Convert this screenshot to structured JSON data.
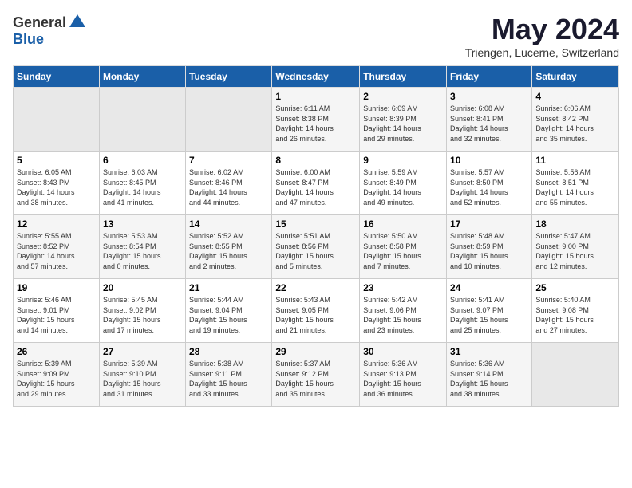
{
  "logo": {
    "general": "General",
    "blue": "Blue"
  },
  "title": "May 2024",
  "subtitle": "Triengen, Lucerne, Switzerland",
  "headers": [
    "Sunday",
    "Monday",
    "Tuesday",
    "Wednesday",
    "Thursday",
    "Friday",
    "Saturday"
  ],
  "weeks": [
    [
      {
        "day": "",
        "info": ""
      },
      {
        "day": "",
        "info": ""
      },
      {
        "day": "",
        "info": ""
      },
      {
        "day": "1",
        "info": "Sunrise: 6:11 AM\nSunset: 8:38 PM\nDaylight: 14 hours\nand 26 minutes."
      },
      {
        "day": "2",
        "info": "Sunrise: 6:09 AM\nSunset: 8:39 PM\nDaylight: 14 hours\nand 29 minutes."
      },
      {
        "day": "3",
        "info": "Sunrise: 6:08 AM\nSunset: 8:41 PM\nDaylight: 14 hours\nand 32 minutes."
      },
      {
        "day": "4",
        "info": "Sunrise: 6:06 AM\nSunset: 8:42 PM\nDaylight: 14 hours\nand 35 minutes."
      }
    ],
    [
      {
        "day": "5",
        "info": "Sunrise: 6:05 AM\nSunset: 8:43 PM\nDaylight: 14 hours\nand 38 minutes."
      },
      {
        "day": "6",
        "info": "Sunrise: 6:03 AM\nSunset: 8:45 PM\nDaylight: 14 hours\nand 41 minutes."
      },
      {
        "day": "7",
        "info": "Sunrise: 6:02 AM\nSunset: 8:46 PM\nDaylight: 14 hours\nand 44 minutes."
      },
      {
        "day": "8",
        "info": "Sunrise: 6:00 AM\nSunset: 8:47 PM\nDaylight: 14 hours\nand 47 minutes."
      },
      {
        "day": "9",
        "info": "Sunrise: 5:59 AM\nSunset: 8:49 PM\nDaylight: 14 hours\nand 49 minutes."
      },
      {
        "day": "10",
        "info": "Sunrise: 5:57 AM\nSunset: 8:50 PM\nDaylight: 14 hours\nand 52 minutes."
      },
      {
        "day": "11",
        "info": "Sunrise: 5:56 AM\nSunset: 8:51 PM\nDaylight: 14 hours\nand 55 minutes."
      }
    ],
    [
      {
        "day": "12",
        "info": "Sunrise: 5:55 AM\nSunset: 8:52 PM\nDaylight: 14 hours\nand 57 minutes."
      },
      {
        "day": "13",
        "info": "Sunrise: 5:53 AM\nSunset: 8:54 PM\nDaylight: 15 hours\nand 0 minutes."
      },
      {
        "day": "14",
        "info": "Sunrise: 5:52 AM\nSunset: 8:55 PM\nDaylight: 15 hours\nand 2 minutes."
      },
      {
        "day": "15",
        "info": "Sunrise: 5:51 AM\nSunset: 8:56 PM\nDaylight: 15 hours\nand 5 minutes."
      },
      {
        "day": "16",
        "info": "Sunrise: 5:50 AM\nSunset: 8:58 PM\nDaylight: 15 hours\nand 7 minutes."
      },
      {
        "day": "17",
        "info": "Sunrise: 5:48 AM\nSunset: 8:59 PM\nDaylight: 15 hours\nand 10 minutes."
      },
      {
        "day": "18",
        "info": "Sunrise: 5:47 AM\nSunset: 9:00 PM\nDaylight: 15 hours\nand 12 minutes."
      }
    ],
    [
      {
        "day": "19",
        "info": "Sunrise: 5:46 AM\nSunset: 9:01 PM\nDaylight: 15 hours\nand 14 minutes."
      },
      {
        "day": "20",
        "info": "Sunrise: 5:45 AM\nSunset: 9:02 PM\nDaylight: 15 hours\nand 17 minutes."
      },
      {
        "day": "21",
        "info": "Sunrise: 5:44 AM\nSunset: 9:04 PM\nDaylight: 15 hours\nand 19 minutes."
      },
      {
        "day": "22",
        "info": "Sunrise: 5:43 AM\nSunset: 9:05 PM\nDaylight: 15 hours\nand 21 minutes."
      },
      {
        "day": "23",
        "info": "Sunrise: 5:42 AM\nSunset: 9:06 PM\nDaylight: 15 hours\nand 23 minutes."
      },
      {
        "day": "24",
        "info": "Sunrise: 5:41 AM\nSunset: 9:07 PM\nDaylight: 15 hours\nand 25 minutes."
      },
      {
        "day": "25",
        "info": "Sunrise: 5:40 AM\nSunset: 9:08 PM\nDaylight: 15 hours\nand 27 minutes."
      }
    ],
    [
      {
        "day": "26",
        "info": "Sunrise: 5:39 AM\nSunset: 9:09 PM\nDaylight: 15 hours\nand 29 minutes."
      },
      {
        "day": "27",
        "info": "Sunrise: 5:39 AM\nSunset: 9:10 PM\nDaylight: 15 hours\nand 31 minutes."
      },
      {
        "day": "28",
        "info": "Sunrise: 5:38 AM\nSunset: 9:11 PM\nDaylight: 15 hours\nand 33 minutes."
      },
      {
        "day": "29",
        "info": "Sunrise: 5:37 AM\nSunset: 9:12 PM\nDaylight: 15 hours\nand 35 minutes."
      },
      {
        "day": "30",
        "info": "Sunrise: 5:36 AM\nSunset: 9:13 PM\nDaylight: 15 hours\nand 36 minutes."
      },
      {
        "day": "31",
        "info": "Sunrise: 5:36 AM\nSunset: 9:14 PM\nDaylight: 15 hours\nand 38 minutes."
      },
      {
        "day": "",
        "info": ""
      }
    ]
  ]
}
